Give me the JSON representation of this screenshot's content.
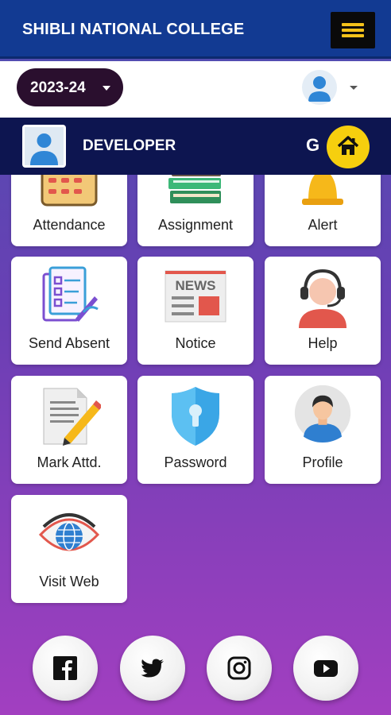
{
  "header": {
    "title": "SHIBLI NATIONAL COLLEGE",
    "menu_icon": "hamburger-menu-icon",
    "accent": "#123a92",
    "menu_color": "#f4c21a"
  },
  "session": {
    "year": "2023-24"
  },
  "user_bar": {
    "name": "DEVELOPER",
    "letter": "G",
    "home_icon": "home-icon",
    "bg": "#0d1550",
    "home_color": "#f6cf0e"
  },
  "tiles": [
    {
      "label": "Attendance",
      "icon": "attendance-calendar-icon"
    },
    {
      "label": "Assignment",
      "icon": "books-icon"
    },
    {
      "label": "Alert",
      "icon": "bell-icon"
    },
    {
      "label": "Send Absent",
      "icon": "checklist-icon"
    },
    {
      "label": "Notice",
      "icon": "newspaper-icon"
    },
    {
      "label": "Help",
      "icon": "support-agent-icon"
    },
    {
      "label": "Mark Attd.",
      "icon": "document-pencil-icon"
    },
    {
      "label": "Password",
      "icon": "shield-keyhole-icon"
    },
    {
      "label": "Profile",
      "icon": "profile-avatar-icon"
    },
    {
      "label": "Visit Web",
      "icon": "eye-globe-icon"
    }
  ],
  "notice_icon_text": "NEWS",
  "socials": [
    {
      "name": "facebook-icon"
    },
    {
      "name": "twitter-icon"
    },
    {
      "name": "instagram-icon"
    },
    {
      "name": "youtube-icon"
    }
  ]
}
